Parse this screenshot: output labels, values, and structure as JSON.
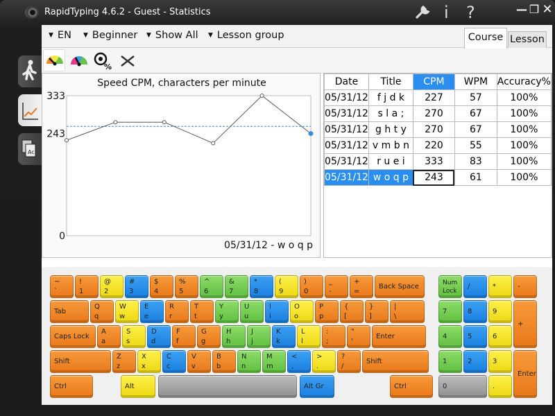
{
  "title": "RapidTyping 4.6.2 - Guest - Statistics",
  "toolbar": {
    "dropdowns": [
      "EN",
      "Beginner",
      "Show All",
      "Lesson group"
    ],
    "tabs": [
      "Course",
      "Lesson"
    ]
  },
  "icons": {
    "settings": "wrench-icon",
    "info": "i",
    "help": "?"
  },
  "chart_data": {
    "type": "line",
    "title": "Speed CPM, characters per minute",
    "x": [
      "05/31/12",
      "05/31/12",
      "05/31/12",
      "05/31/12",
      "05/31/12",
      "05/31/12"
    ],
    "values": [
      227,
      270,
      270,
      220,
      333,
      243
    ],
    "ylim": [
      0,
      333
    ],
    "ytick_labels": [
      "333",
      "243",
      "0"
    ],
    "average_line": 260,
    "caption": "05/31/12 - w o q p",
    "grid": false,
    "color": "#555555",
    "average_color": "#3a8fd8"
  },
  "table": {
    "headers": [
      "Date",
      "Title",
      "CPM",
      "WPM",
      "Accuracy%"
    ],
    "selected_header": 2,
    "selected_row": 5,
    "rows": [
      [
        "05/31/12",
        "f j d k",
        "227",
        "57",
        "100%"
      ],
      [
        "05/31/12",
        "s l a ;",
        "270",
        "67",
        "100%"
      ],
      [
        "05/31/12",
        "g h t y",
        "270",
        "67",
        "100%"
      ],
      [
        "05/31/12",
        "v m b n",
        "220",
        "55",
        "100%"
      ],
      [
        "05/31/12",
        "r u e i",
        "333",
        "83",
        "100%"
      ],
      [
        "05/31/12",
        "w o q p",
        "243",
        "61",
        "100%"
      ]
    ]
  },
  "keyboard": {
    "rows": [
      [
        [
          "~",
          "`",
          "O"
        ],
        [
          "!",
          "1",
          "O"
        ],
        [
          "@",
          "2",
          "Y"
        ],
        [
          "#",
          "3",
          "B"
        ],
        [
          "$",
          "4",
          "O"
        ],
        [
          "%",
          "5",
          "O"
        ],
        [
          "^",
          "6",
          "G"
        ],
        [
          "&",
          "7",
          "G"
        ],
        [
          "*",
          "8",
          "B"
        ],
        [
          "(",
          "9",
          "Y"
        ],
        [
          ")",
          "0",
          "O"
        ],
        [
          "_",
          "-",
          "O"
        ],
        [
          "+",
          "=",
          "O"
        ],
        [
          "Back Space",
          "",
          "O"
        ]
      ],
      [
        [
          "Tab",
          "",
          "O"
        ],
        [
          "Q",
          "q",
          "O"
        ],
        [
          "W",
          "w",
          "Y"
        ],
        [
          "E",
          "e",
          "B"
        ],
        [
          "R",
          "r",
          "O"
        ],
        [
          "T",
          "t",
          "O"
        ],
        [
          "Y",
          "y",
          "G"
        ],
        [
          "U",
          "u",
          "G"
        ],
        [
          "I",
          "i",
          "B"
        ],
        [
          "O",
          "o",
          "Y"
        ],
        [
          "P",
          "p",
          "O"
        ],
        [
          "{",
          "[",
          "O"
        ],
        [
          "}",
          "]",
          "O"
        ],
        [
          "|",
          "\\",
          "O"
        ]
      ],
      [
        [
          "Caps Lock",
          "",
          "O"
        ],
        [
          "A",
          "a",
          "O"
        ],
        [
          "S",
          "s",
          "Y"
        ],
        [
          "D",
          "d",
          "B"
        ],
        [
          "F",
          "f",
          "O"
        ],
        [
          "G",
          "g",
          "O"
        ],
        [
          "H",
          "h",
          "G"
        ],
        [
          "J",
          "j",
          "G"
        ],
        [
          "K",
          "k",
          "B"
        ],
        [
          "L",
          "l",
          "Y"
        ],
        [
          ":",
          ";",
          "O"
        ],
        [
          "\"",
          "'",
          "O"
        ],
        [
          "Enter",
          "",
          "O"
        ]
      ],
      [
        [
          "Shift",
          "",
          "O"
        ],
        [
          "Z",
          "z",
          "O"
        ],
        [
          "X",
          "x",
          "Y"
        ],
        [
          "C",
          "c",
          "B"
        ],
        [
          "V",
          "v",
          "O"
        ],
        [
          "B",
          "b",
          "O"
        ],
        [
          "N",
          "n",
          "G"
        ],
        [
          "M",
          "m",
          "G"
        ],
        [
          "<",
          ",",
          "B"
        ],
        [
          ">",
          ".",
          "Y"
        ],
        [
          "?",
          "/",
          "O"
        ],
        [
          "Shift",
          "",
          "O"
        ]
      ],
      [
        [
          "Ctrl",
          "",
          "O"
        ],
        [
          "Alt",
          "",
          "Y"
        ],
        [
          "",
          "",
          "S"
        ],
        [
          "Alt Gr",
          "",
          "B"
        ],
        [
          "Ctrl",
          "",
          "O"
        ]
      ]
    ],
    "numpad": [
      [
        "Num Lock",
        "",
        "G"
      ],
      [
        "/",
        "",
        "B"
      ],
      [
        "*",
        "",
        "Y"
      ],
      [
        "-",
        "",
        "O"
      ],
      [
        "7",
        "",
        "G"
      ],
      [
        "8",
        "",
        "B"
      ],
      [
        "9",
        "",
        "Y"
      ],
      [
        "+",
        "",
        "O"
      ],
      [
        "4",
        "",
        "G"
      ],
      [
        "5",
        "",
        "B"
      ],
      [
        "6",
        "",
        "Y"
      ],
      [
        "1",
        "",
        "G"
      ],
      [
        "2",
        "",
        "B"
      ],
      [
        "3",
        "",
        "Y"
      ],
      [
        "Enter",
        "",
        "O"
      ],
      [
        "0",
        "",
        "S"
      ],
      [
        ".",
        "",
        "Y"
      ]
    ]
  }
}
